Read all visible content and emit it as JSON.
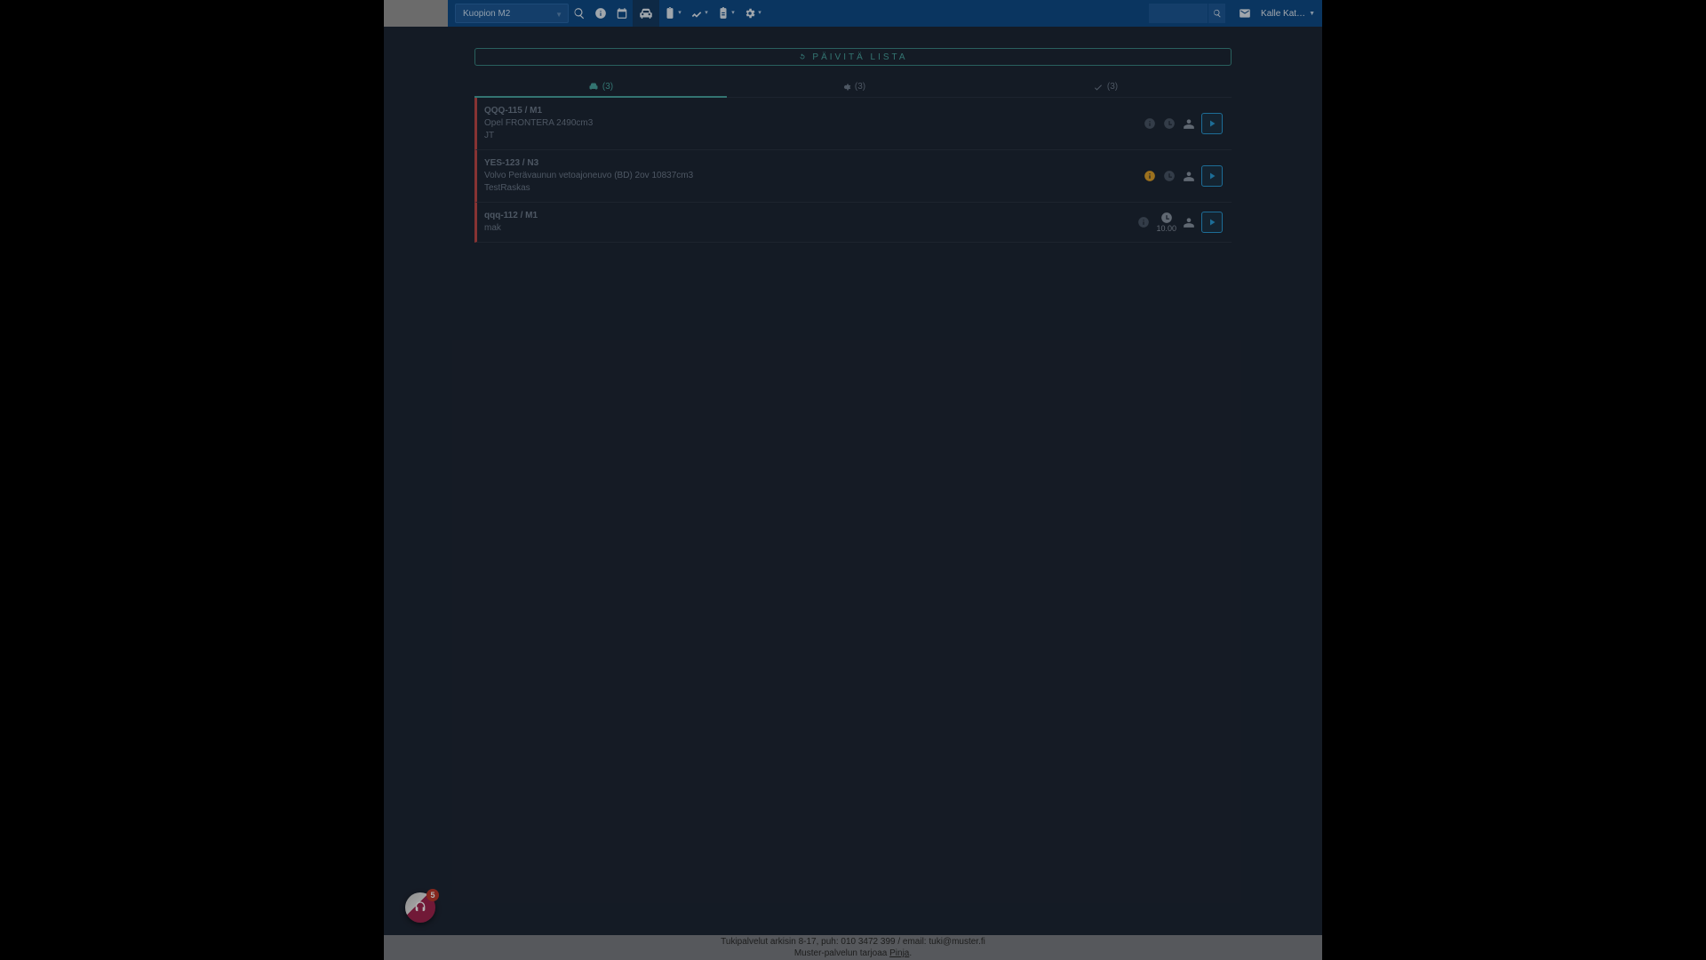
{
  "header": {
    "station": "Kuopion M2",
    "user": "Kalle Kat…"
  },
  "refresh": {
    "label": "PÄIVITÄ LISTA"
  },
  "tabs": {
    "waiting": "(3)",
    "inprogress": "(3)",
    "done": "(3)"
  },
  "rows": [
    {
      "title": "QQQ-115 / M1",
      "sub": "Opel FRONTERA 2490cm3",
      "by": "JT",
      "warn": false,
      "clock": false,
      "time": ""
    },
    {
      "title": "YES-123 / N3",
      "sub": "Volvo Perävaunun vetoajoneuvo (BD) 2ov 10837cm3",
      "by": "TestRaskas",
      "warn": true,
      "clock": false,
      "time": ""
    },
    {
      "title": "qqq-112 / M1",
      "sub": "mak",
      "by": "",
      "warn": false,
      "clock": true,
      "time": "10.00"
    }
  ],
  "footer": {
    "line1": "Tukipalvelut arkisin 8-17, puh: 010 3472 399 / email: tuki@muster.fi",
    "line2a": "Muster-palvelun tarjoaa ",
    "line2link": "Pinja",
    "line2b": "."
  },
  "widget": {
    "badge": "5"
  }
}
